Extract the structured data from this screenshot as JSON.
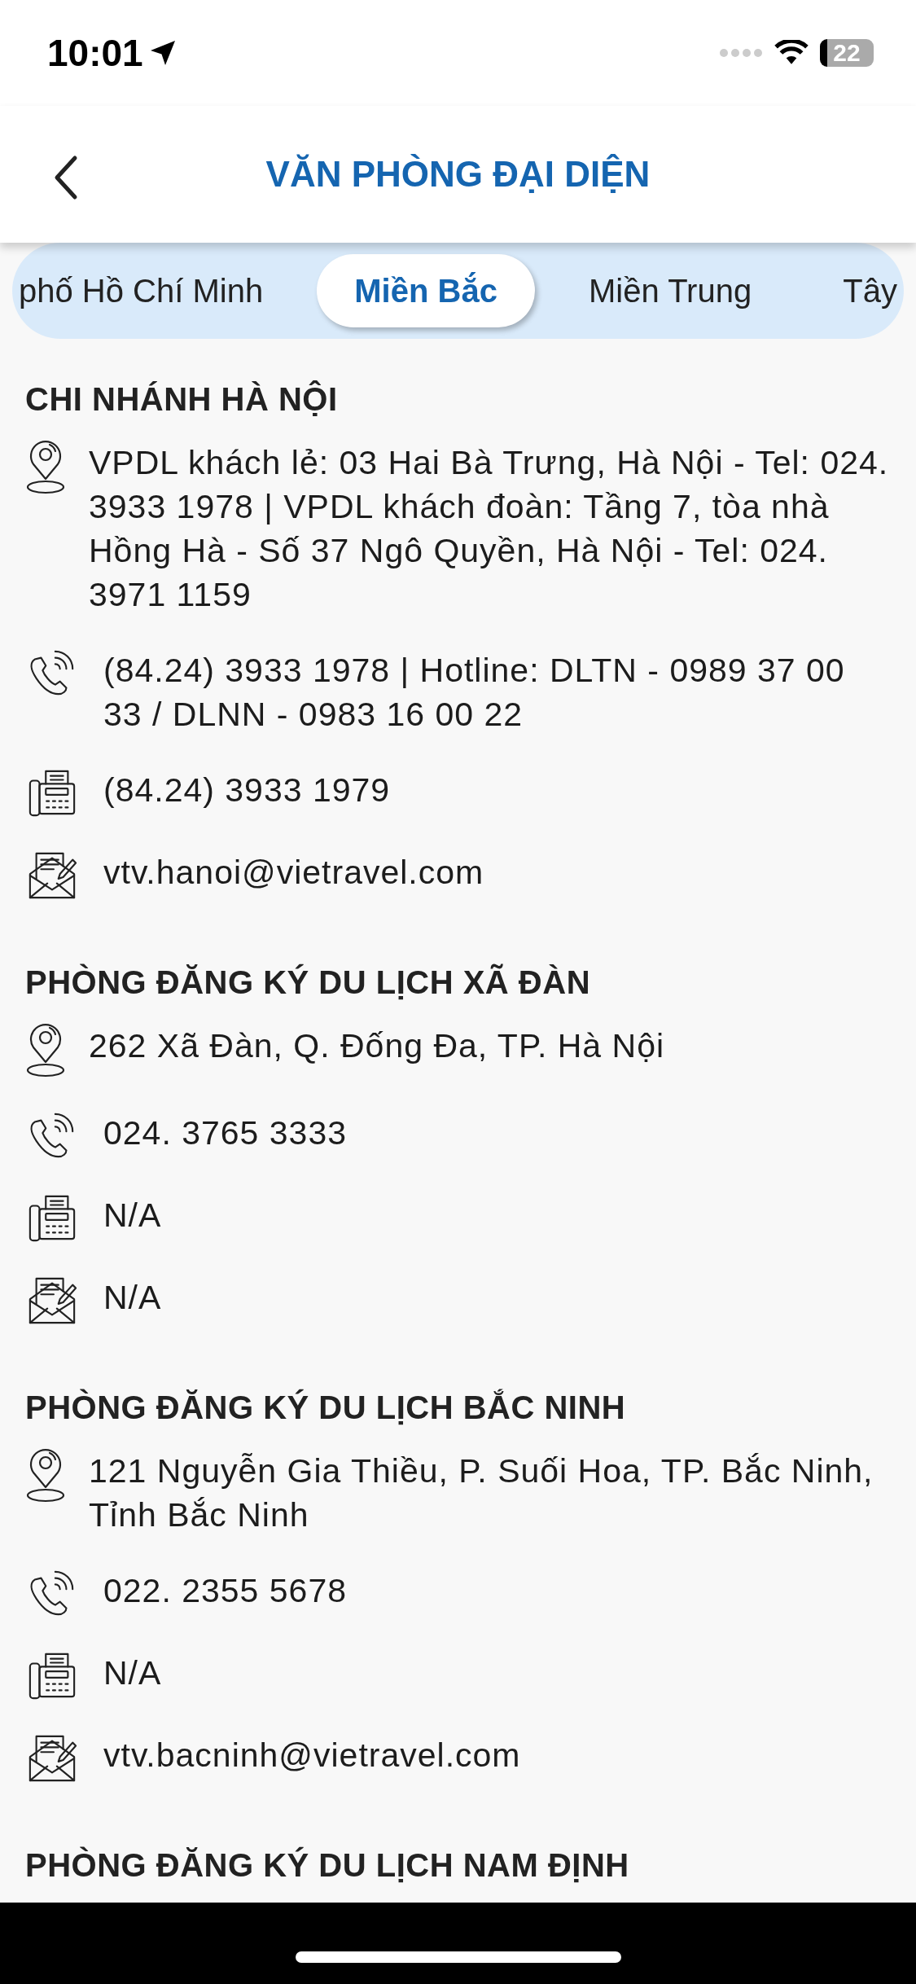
{
  "status_bar": {
    "time": "10:01",
    "battery": "22"
  },
  "header": {
    "title": "VĂN PHÒNG ĐẠI DIỆN"
  },
  "tabs": [
    {
      "label": "phố Hồ Chí Minh",
      "selected": false
    },
    {
      "label": "Miền Bắc",
      "selected": true
    },
    {
      "label": "Miền Trung",
      "selected": false
    },
    {
      "label": "Tây",
      "selected": false
    }
  ],
  "sections": [
    {
      "title": "CHI NHÁNH HÀ NỘI",
      "items": [
        {
          "kind": "address",
          "text": "VPDL khách lẻ: 03 Hai Bà Trưng, Hà Nội - Tel: 024. 3933 1978 | VPDL khách đoàn: Tầng 7, tòa nhà Hồng Hà - Số 37 Ngô Quyền, Hà Nội - Tel: 024. 3971 1159"
        },
        {
          "kind": "phone",
          "text": "(84.24) 3933 1978 | Hotline: DLTN - 0989 37 00 33 / DLNN - 0983 16 00 22"
        },
        {
          "kind": "fax",
          "text": "(84.24) 3933 1979"
        },
        {
          "kind": "email",
          "text": "vtv.hanoi@vietravel.com"
        }
      ]
    },
    {
      "title": "PHÒNG ĐĂNG KÝ DU LỊCH XÃ ĐÀN",
      "items": [
        {
          "kind": "address",
          "text": "262 Xã Đàn, Q. Đống Đa, TP. Hà Nội"
        },
        {
          "kind": "phone",
          "text": "024. 3765 3333"
        },
        {
          "kind": "fax",
          "text": "N/A"
        },
        {
          "kind": "email",
          "text": "N/A"
        }
      ]
    },
    {
      "title": "PHÒNG ĐĂNG KÝ DU LỊCH BẮC NINH",
      "items": [
        {
          "kind": "address",
          "text": "121 Nguyễn Gia Thiều, P. Suối Hoa, TP. Bắc Ninh, Tỉnh Bắc Ninh"
        },
        {
          "kind": "phone",
          "text": "022. 2355 5678"
        },
        {
          "kind": "fax",
          "text": "N/A"
        },
        {
          "kind": "email",
          "text": "vtv.bacninh@vietravel.com"
        }
      ]
    },
    {
      "title": "PHÒNG ĐĂNG KÝ DU LỊCH NAM ĐỊNH"
    }
  ]
}
